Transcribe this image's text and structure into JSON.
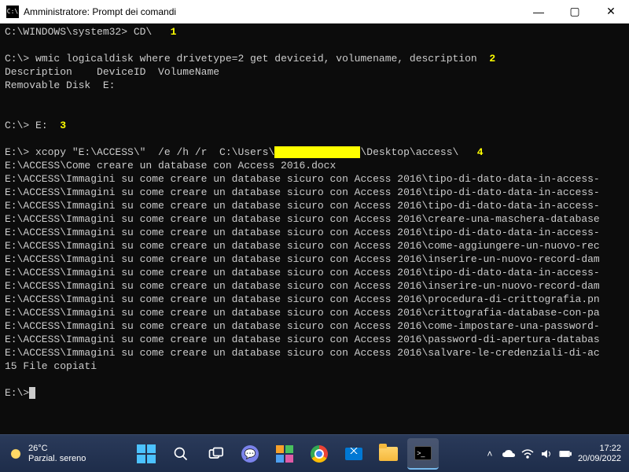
{
  "window": {
    "title": "Amministratore: Prompt dei comandi"
  },
  "annotations": {
    "a1": "1",
    "a2": "2",
    "a3": "3",
    "a4": "4"
  },
  "term": {
    "l1_prompt": "C:\\WINDOWS\\system32> ",
    "l1_cmd": "CD\\   ",
    "l2_prompt": "C:\\> ",
    "l2_cmd": "wmic logicaldisk where drivetype=2 get deviceid, volumename, description  ",
    "l3": "Description    DeviceID  VolumeName",
    "l4": "Removable Disk  E:",
    "l5_prompt": "C:\\> ",
    "l5_cmd": "E:  ",
    "l6_prompt": "E:\\> ",
    "l6_cmd_a": "xcopy \"E:\\ACCESS\\\"  /e /h /r  C:\\Users\\",
    "l6_redact": "xxxxxxxxxxxxxx",
    "l6_cmd_b": "\\Desktop\\access\\   ",
    "out1": "E:\\ACCESS\\Come creare un database con Access 2016.docx",
    "out2": "E:\\ACCESS\\Immagini su come creare un database sicuro con Access 2016\\tipo-di-dato-data-in-access-",
    "out3": "E:\\ACCESS\\Immagini su come creare un database sicuro con Access 2016\\tipo-di-dato-data-in-access-",
    "out4": "E:\\ACCESS\\Immagini su come creare un database sicuro con Access 2016\\tipo-di-dato-data-in-access-",
    "out5": "E:\\ACCESS\\Immagini su come creare un database sicuro con Access 2016\\creare-una-maschera-database",
    "out6": "E:\\ACCESS\\Immagini su come creare un database sicuro con Access 2016\\tipo-di-dato-data-in-access-",
    "out7": "E:\\ACCESS\\Immagini su come creare un database sicuro con Access 2016\\come-aggiungere-un-nuovo-rec",
    "out8": "E:\\ACCESS\\Immagini su come creare un database sicuro con Access 2016\\inserire-un-nuovo-record-dam",
    "out9": "E:\\ACCESS\\Immagini su come creare un database sicuro con Access 2016\\tipo-di-dato-data-in-access-",
    "out10": "E:\\ACCESS\\Immagini su come creare un database sicuro con Access 2016\\inserire-un-nuovo-record-dam",
    "out11": "E:\\ACCESS\\Immagini su come creare un database sicuro con Access 2016\\procedura-di-crittografia.pn",
    "out12": "E:\\ACCESS\\Immagini su come creare un database sicuro con Access 2016\\crittografia-database-con-pa",
    "out13": "E:\\ACCESS\\Immagini su come creare un database sicuro con Access 2016\\come-impostare-una-password-",
    "out14": "E:\\ACCESS\\Immagini su come creare un database sicuro con Access 2016\\password-di-apertura-databas",
    "out15": "E:\\ACCESS\\Immagini su come creare un database sicuro con Access 2016\\salvare-le-credenziali-di-ac",
    "summary": "15 File copiati",
    "final_prompt": "E:\\>"
  },
  "taskbar": {
    "weather_temp": "26°C",
    "weather_desc": "Parzial. sereno",
    "time": "17:22",
    "date": "20/09/2022"
  }
}
